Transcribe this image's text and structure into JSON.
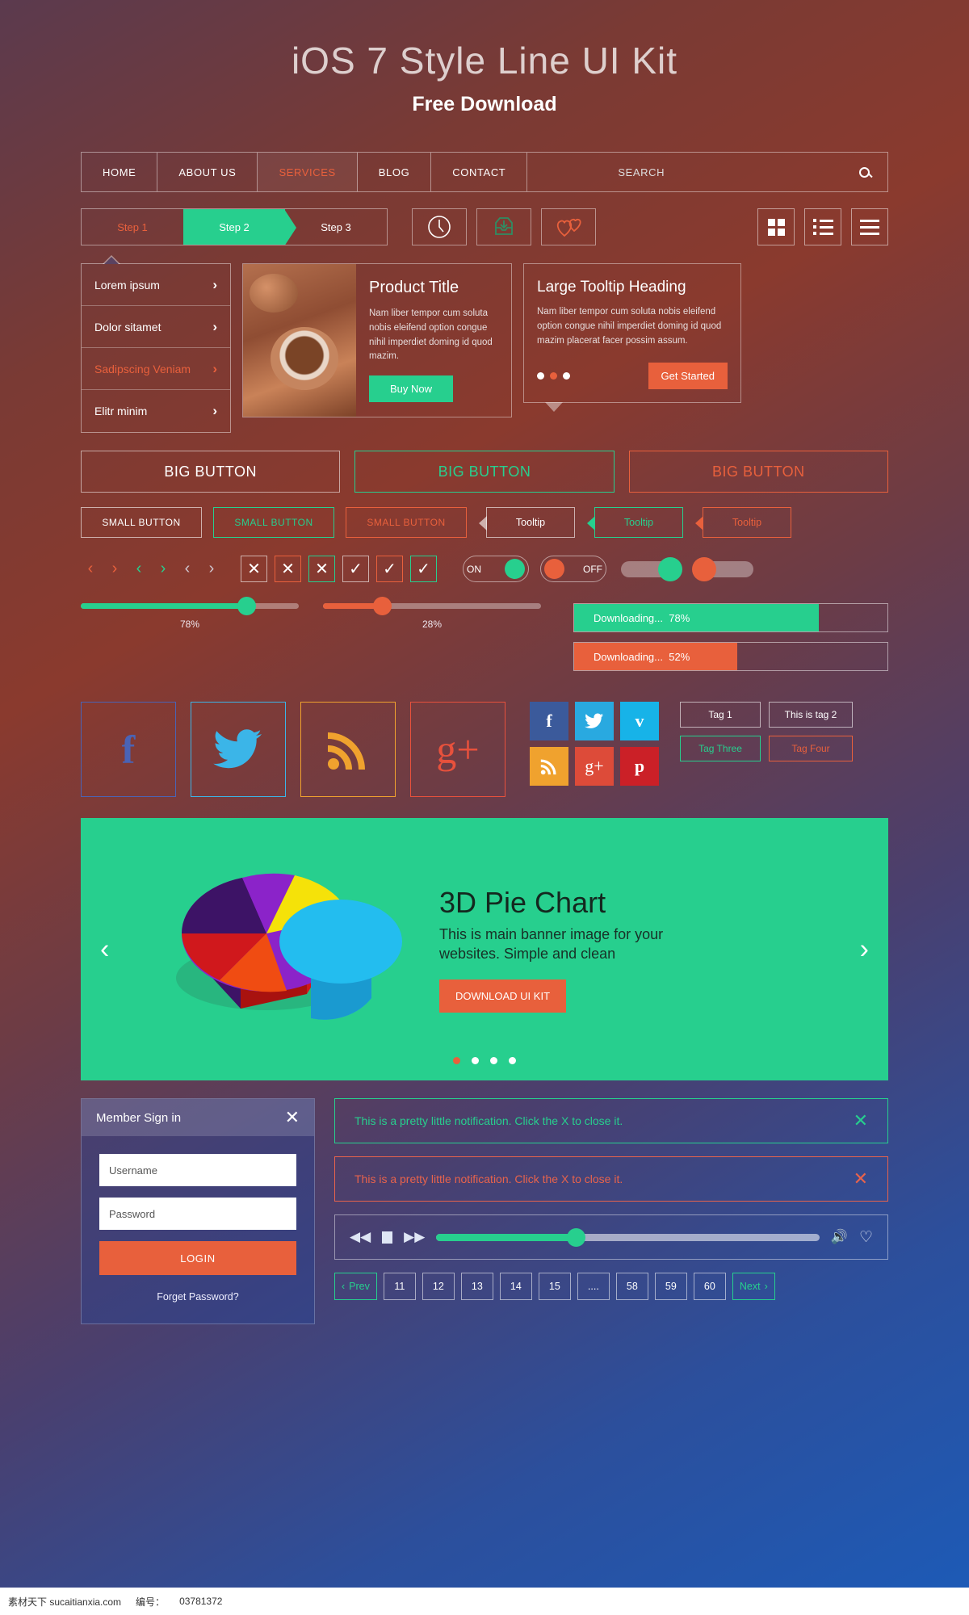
{
  "hero": {
    "title": "iOS 7 Style Line UI Kit",
    "subtitle": "Free Download"
  },
  "nav": {
    "items": [
      "HOME",
      "ABOUT US",
      "SERVICES",
      "BLOG",
      "CONTACT"
    ],
    "active": "SERVICES",
    "search_placeholder": "SEARCH",
    "search_icon": "search-icon"
  },
  "steps": {
    "items": [
      "Step 1",
      "Step 2",
      "Step 3"
    ],
    "active": "Step 2"
  },
  "icon_buttons": [
    "clock-icon",
    "inbox-download-icon",
    "hearts-icon"
  ],
  "view_buttons": [
    "grid-view-icon",
    "list-view-icon",
    "menu-bars-icon"
  ],
  "menu_list": {
    "items": [
      "Lorem ipsum",
      "Dolor sitamet",
      "Sadipscing Veniam",
      "Elitr minim"
    ],
    "highlighted": "Sadipscing Veniam",
    "chevron": "›"
  },
  "product_card": {
    "title": "Product Title",
    "text": "Nam liber tempor cum soluta nobis eleifend option congue nihil imperdiet doming id quod mazim.",
    "button": "Buy Now"
  },
  "tooltip_card": {
    "title": "Large Tooltip Heading",
    "text": "Nam liber tempor cum soluta nobis eleifend option congue nihil imperdiet doming id quod mazim placerat facer possim assum.",
    "button": "Get Started",
    "dots": 3,
    "active_dot": 1
  },
  "big_buttons": [
    "BIG BUTTON",
    "BIG BUTTON",
    "BIG BUTTON"
  ],
  "small_buttons": [
    "SMALL BUTTON",
    "SMALL BUTTON",
    "SMALL BUTTON"
  ],
  "tooltips": [
    "Tooltip",
    "Tooltip",
    "Tooltip"
  ],
  "arrows": [
    "‹",
    "›",
    "‹",
    "›",
    "‹",
    "›"
  ],
  "checkboxes": {
    "crosses": [
      "✕",
      "✕",
      "✕"
    ],
    "ticks": [
      "✓",
      "✓",
      "✓"
    ]
  },
  "toggles": {
    "on_label": "ON",
    "off_label": "OFF"
  },
  "sliders": [
    {
      "value": 78,
      "label": "78%",
      "color": "#27cf8e"
    },
    {
      "value": 28,
      "label": "28%",
      "color": "#e8603c"
    }
  ],
  "progress": [
    {
      "label": "Downloading...",
      "value": "78%",
      "percent": 78,
      "color": "#27cf8e"
    },
    {
      "label": "Downloading...",
      "value": "52%",
      "percent": 52,
      "color": "#e8603c"
    }
  ],
  "social_large": [
    {
      "icon": "facebook-icon",
      "glyph": "f",
      "color": "#4a63b5"
    },
    {
      "icon": "twitter-icon",
      "glyph": "",
      "color": "#3bb5e8"
    },
    {
      "icon": "rss-icon",
      "glyph": "",
      "color": "#f0a22e"
    },
    {
      "icon": "google-plus-icon",
      "glyph": "g+",
      "color": "#e8513c"
    }
  ],
  "social_small": [
    {
      "icon": "facebook-icon",
      "glyph": "f",
      "color": "#3b5a9b"
    },
    {
      "icon": "twitter-icon",
      "glyph": "t",
      "color": "#29a9e0"
    },
    {
      "icon": "vimeo-icon",
      "glyph": "v",
      "color": "#17b3e8"
    },
    {
      "icon": "rss-icon",
      "glyph": "r",
      "color": "#f0a22e"
    },
    {
      "icon": "google-plus-icon",
      "glyph": "g+",
      "color": "#dd4b39"
    },
    {
      "icon": "pinterest-icon",
      "glyph": "p",
      "color": "#cb2027"
    }
  ],
  "tags": [
    "Tag 1",
    "This is tag 2",
    "Tag Three",
    "Tag Four"
  ],
  "banner": {
    "heading": "3D Pie Chart",
    "text": "This is main banner image for your websites. Simple and clean",
    "button": "DOWNLOAD UI KIT",
    "prev_icon": "chevron-left-icon",
    "next_icon": "chevron-right-icon",
    "dots": 4,
    "active_dot": 0,
    "accent": "#27cf8e"
  },
  "chart_data": {
    "type": "pie",
    "title": "3D Pie Chart",
    "labels": [
      "Yellow",
      "Cyan",
      "Red",
      "Orange",
      "Purple",
      "Dark Purple"
    ],
    "values": [
      14,
      26,
      18,
      12,
      16,
      14
    ],
    "colors": [
      "#f5e209",
      "#23bdef",
      "#d0181c",
      "#f04c12",
      "#8b23c9",
      "#3d1366"
    ],
    "legend": "none",
    "grid": false
  },
  "signin": {
    "title": "Member Sign in",
    "close_icon": "close-icon",
    "username_placeholder": "Username",
    "password_placeholder": "Password",
    "login_label": "LOGIN",
    "forget_label": "Forget Password?"
  },
  "notifications": [
    {
      "text": "This is a pretty little notification. Click the X to close it.",
      "color": "#27cf8e",
      "close_icon": "close-icon"
    },
    {
      "text": "This is a pretty little notification. Click the X to close it.",
      "color": "#e8634c",
      "close_icon": "close-icon"
    }
  ],
  "player": {
    "rewind_icon": "rewind-icon",
    "stop_icon": "stop-icon",
    "forward_icon": "fast-forward-icon",
    "volume_icon": "volume-icon",
    "heart_icon": "heart-icon",
    "progress_percent": 38
  },
  "pagination": {
    "prev": "Prev",
    "next": "Next",
    "pages": [
      "11",
      "12",
      "13",
      "14",
      "15",
      "....",
      "58",
      "59",
      "60"
    ]
  },
  "footer": {
    "site": "素材天下 sucaitianxia.com",
    "code_label": "编号：",
    "code": "03781372"
  }
}
